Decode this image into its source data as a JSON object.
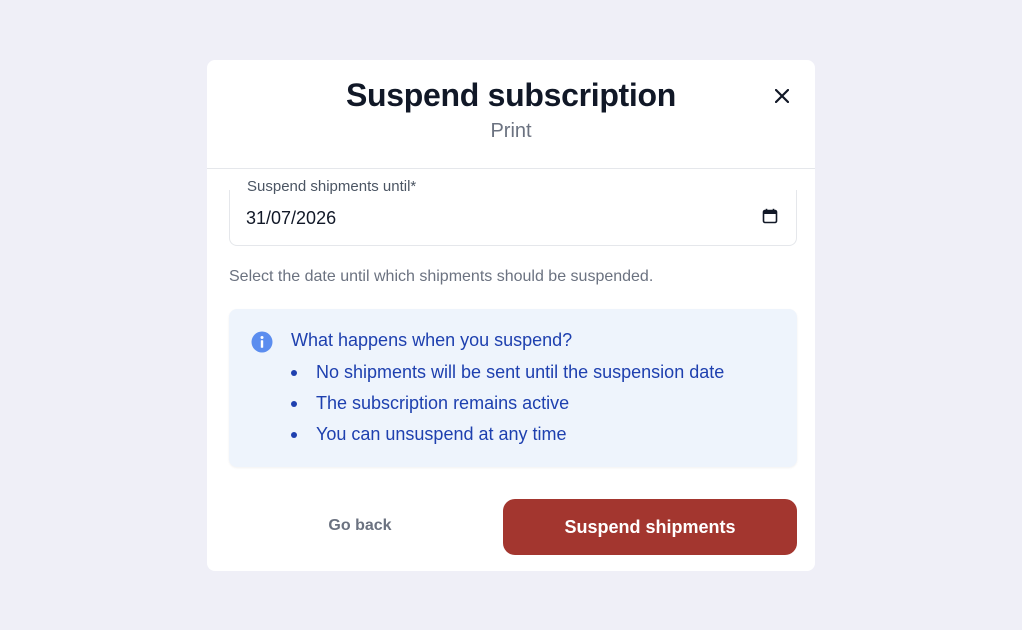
{
  "modal": {
    "title": "Suspend subscription",
    "subtitle": "Print"
  },
  "form": {
    "date_label": "Suspend shipments until*",
    "date_value": "31/07/2026",
    "helper_text": "Select the date until which shipments should be suspended."
  },
  "info": {
    "title": "What happens when you suspend?",
    "items": [
      "No shipments will be sent until the suspension date",
      "The subscription remains active",
      "You can unsuspend at any time"
    ]
  },
  "actions": {
    "back_label": "Go back",
    "submit_label": "Suspend shipments"
  },
  "colors": {
    "background": "#efeff7",
    "info_accent": "#1e40af",
    "info_background": "#eef4fc",
    "danger": "#a3362f"
  },
  "icons": {
    "close": "close-icon",
    "calendar": "calendar-icon",
    "info": "info-icon"
  }
}
